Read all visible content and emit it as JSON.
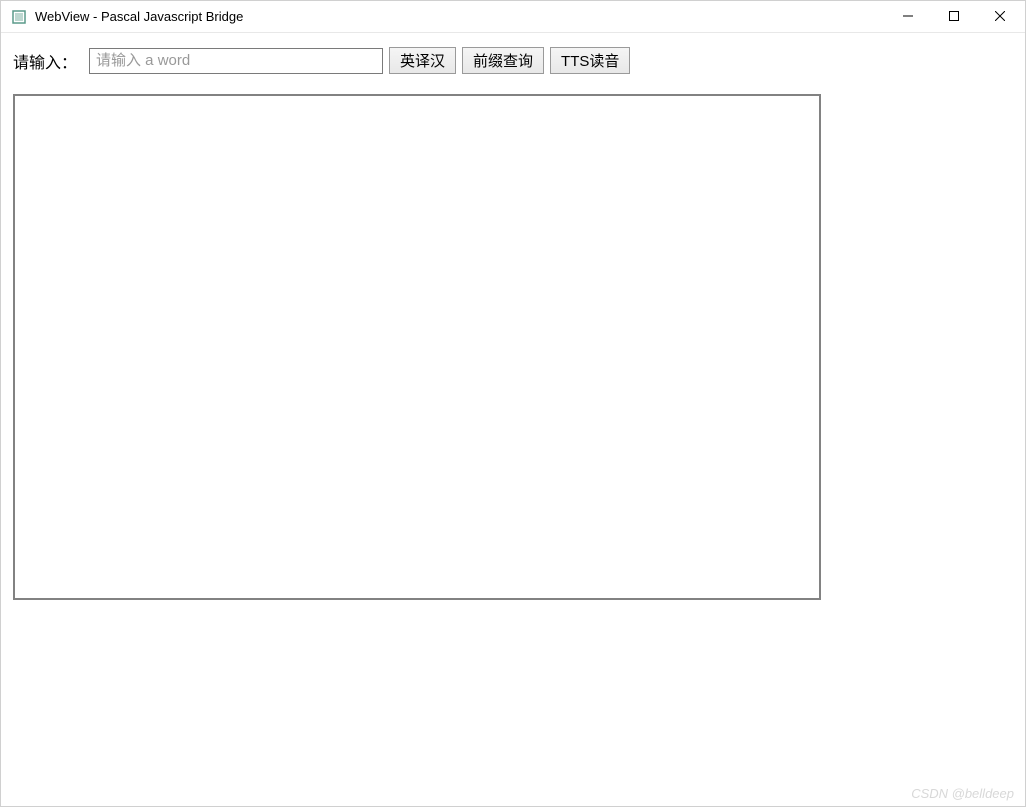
{
  "window": {
    "title": "WebView - Pascal Javascript Bridge"
  },
  "form": {
    "label": "请输入：",
    "input_placeholder": "请输入 a word",
    "input_value": "",
    "buttons": {
      "translate": "英译汉",
      "prefix_query": "前缀查询",
      "tts": "TTS读音"
    }
  },
  "watermark": "CSDN @belldeep"
}
